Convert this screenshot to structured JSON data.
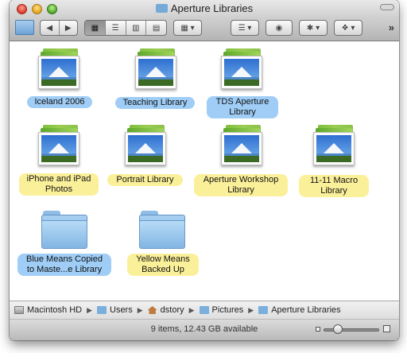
{
  "window": {
    "title": "Aperture Libraries"
  },
  "toolbar": {
    "back_label": "◀",
    "forward_label": "▶",
    "view_icon_label": "▦",
    "view_list_label": "☰",
    "view_column_label": "▥",
    "view_coverflow_label": "▤",
    "arrange_label": "▦ ▾",
    "action_label": "☰ ▾",
    "quicklook_label": "◉",
    "gear_label": "✱ ▾",
    "dropbox_label": "❖ ▾",
    "overflow_label": "»"
  },
  "items": [
    {
      "label": "Iceland 2006",
      "kind": "library",
      "highlight": "blue"
    },
    {
      "label": "Teaching Library",
      "kind": "library",
      "highlight": "blue"
    },
    {
      "label": "TDS Aperture Library",
      "kind": "library",
      "highlight": "blue"
    },
    {
      "label": "iPhone and iPad Photos",
      "kind": "library",
      "highlight": "yellow"
    },
    {
      "label": "Portrait Library",
      "kind": "library",
      "highlight": "yellow"
    },
    {
      "label": "Aperture Workshop Library",
      "kind": "library",
      "highlight": "yellow"
    },
    {
      "label": "11-11 Macro Library",
      "kind": "library",
      "highlight": "yellow"
    },
    {
      "label": "Blue Means Copied to Maste...e Library",
      "kind": "folder",
      "highlight": "blue"
    },
    {
      "label": "Yellow Means Backed Up",
      "kind": "folder",
      "highlight": "yellow"
    }
  ],
  "labels": {
    "l0": "Iceland 2006",
    "l1": "Teaching Library",
    "l2a": "TDS Aperture",
    "l2b": "Library",
    "l3a": "iPhone and iPad",
    "l3b": "Photos",
    "l4": "Portrait Library",
    "l5a": "Aperture Workshop",
    "l5b": "Library",
    "l6a": "11-11 Macro",
    "l6b": "Library",
    "l7a": "Blue Means Copied",
    "l7b": "to Maste...e Library",
    "l8a": "Yellow Means",
    "l8b": "Backed Up"
  },
  "pathbar": {
    "items": [
      "Macintosh HD",
      "Users",
      "dstory",
      "Pictures",
      "Aperture Libraries"
    ]
  },
  "status": {
    "text": "9 items, 12.43 GB available",
    "icon_size_level": 0.25
  },
  "colors": {
    "highlight_blue": "#9fcdf6",
    "highlight_yellow": "#fbf09a"
  }
}
